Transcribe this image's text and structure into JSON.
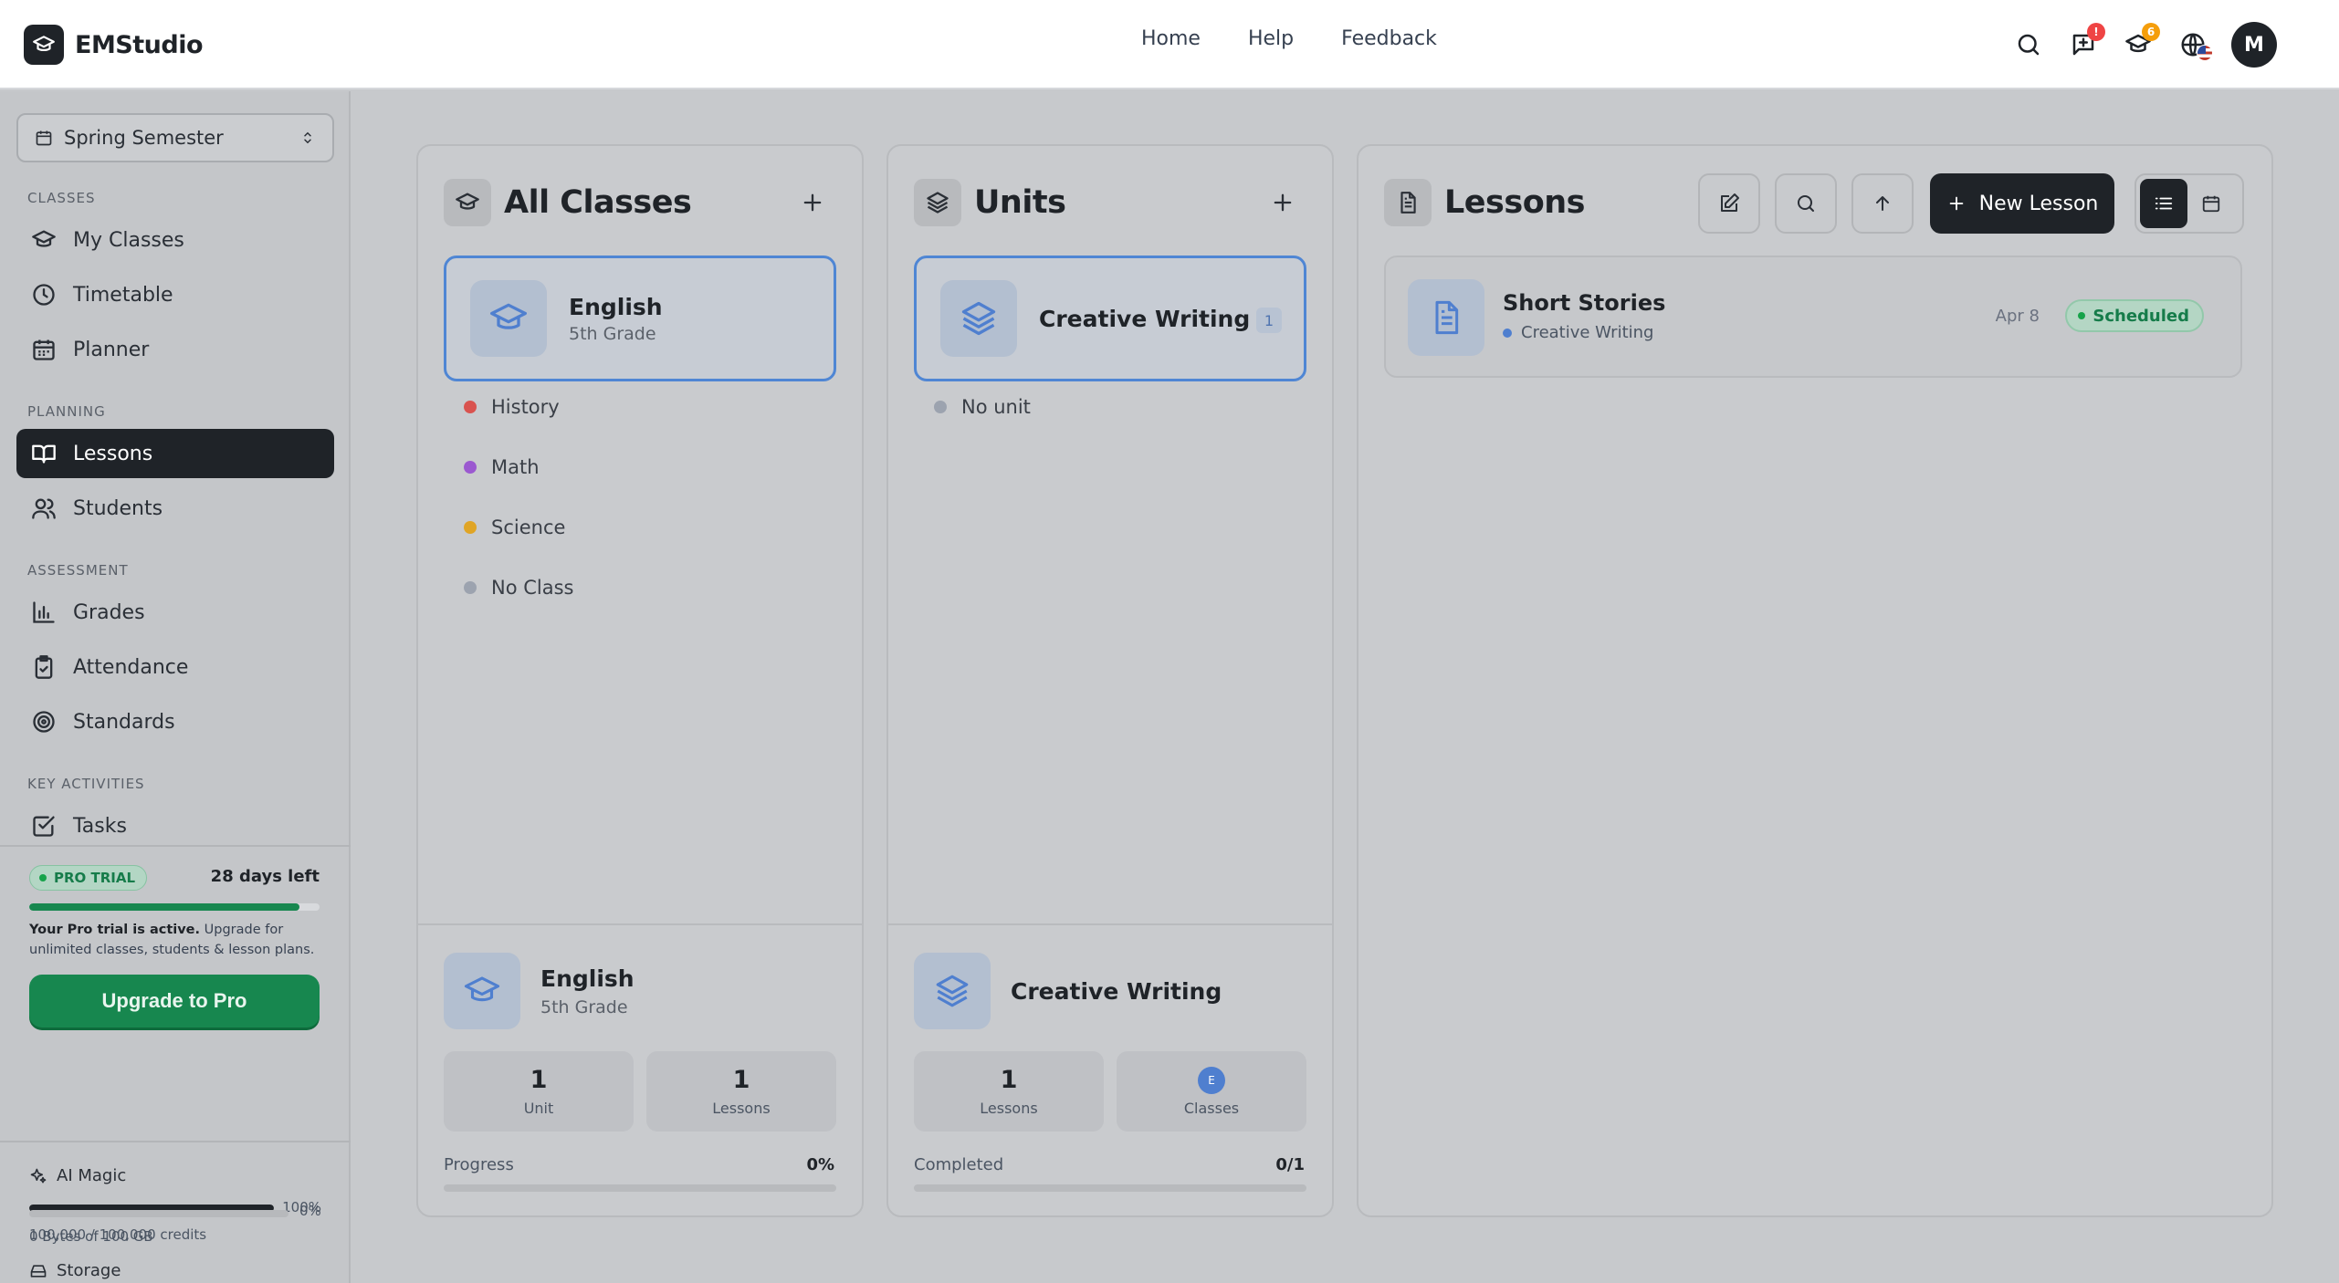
{
  "app": {
    "name": "EMStudio"
  },
  "topnav": {
    "home": "Home",
    "help": "Help",
    "feedback": "Feedback"
  },
  "topbar": {
    "chat_badge": "!",
    "classes_badge": "6",
    "avatar_initial": "M"
  },
  "sidebar": {
    "semester": "Spring Semester",
    "sections": {
      "classes": "CLASSES",
      "planning": "PLANNING",
      "assessment": "ASSESSMENT",
      "key_activities": "KEY ACTIVITIES"
    },
    "items": {
      "my_classes": "My Classes",
      "timetable": "Timetable",
      "planner": "Planner",
      "lessons": "Lessons",
      "students": "Students",
      "grades": "Grades",
      "attendance": "Attendance",
      "standards": "Standards",
      "tasks": "Tasks"
    },
    "trial": {
      "badge": "PRO TRIAL",
      "days_left": "28 days left",
      "progress": 0.93,
      "text_bold": "Your Pro trial is active.",
      "text_rest": " Upgrade for unlimited classes, students & lesson plans.",
      "upgrade_label": "Upgrade to Pro"
    },
    "usage": {
      "ai_label": "AI Magic",
      "ai_pct": "100%",
      "ai_fraction": 1.0,
      "ai_credits": "100,000 / 100,000 credits",
      "storage_label": "Storage",
      "storage_pct": "0%",
      "storage_fraction": 0.0,
      "storage_sub": "0 Bytes of 100 GB"
    }
  },
  "classes_panel": {
    "title": "All Classes",
    "selected": {
      "name": "English",
      "grade": "5th Grade"
    },
    "others": [
      {
        "name": "History",
        "color": "#d9534f"
      },
      {
        "name": "Math",
        "color": "#9b59d0"
      },
      {
        "name": "Science",
        "color": "#e0a526"
      },
      {
        "name": "No Class",
        "color": "#9ca3af"
      }
    ],
    "footer": {
      "name": "English",
      "grade": "5th Grade",
      "stat1_n": "1",
      "stat1_l": "Unit",
      "stat2_n": "1",
      "stat2_l": "Lessons",
      "progress_label": "Progress",
      "progress_value": "0%"
    }
  },
  "units_panel": {
    "title": "Units",
    "selected": {
      "name": "Creative Writing",
      "count": "1"
    },
    "others": [
      {
        "name": "No unit",
        "color": "#9ca3af"
      }
    ],
    "footer": {
      "name": "Creative Writing",
      "stat1_n": "1",
      "stat1_l": "Lessons",
      "class_initial": "E",
      "stat2_l": "Classes",
      "completed_label": "Completed",
      "completed_value": "0/1"
    }
  },
  "lessons_panel": {
    "title": "Lessons",
    "new_lesson_label": "New Lesson",
    "lessons": [
      {
        "title": "Short Stories",
        "unit": "Creative Writing",
        "date": "Apr 8",
        "status": "Scheduled"
      }
    ]
  }
}
